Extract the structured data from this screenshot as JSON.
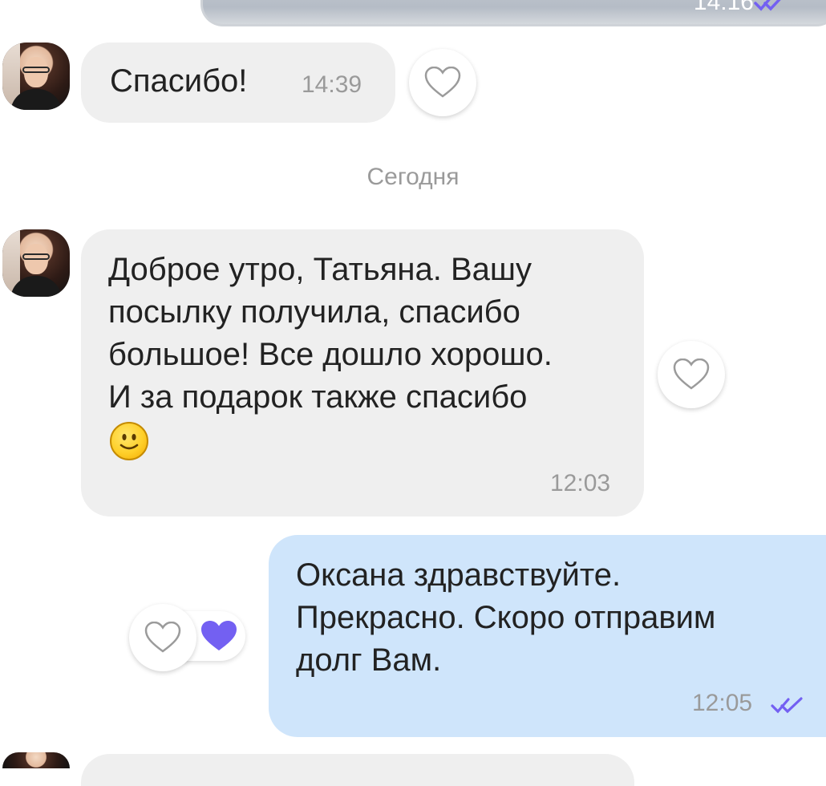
{
  "colors": {
    "incoming_bubble": "#efefef",
    "outgoing_bubble": "#cfe5fb",
    "accent_purple": "#7360f2",
    "timestamp": "#9a9a9a",
    "text": "#222222"
  },
  "previous_message": {
    "time": "14:16",
    "status_icon": "double-check-icon"
  },
  "messages": [
    {
      "direction": "incoming",
      "text": "Спасибо!",
      "time": "14:39",
      "liked": false
    },
    {
      "direction": "incoming",
      "text": "Доброе утро, Татьяна. Вашу\nпосылку получила, спасибо\nбольшое! Все дошло хорошо.\nИ за подарок также спасибо",
      "emoji": "slightly-smiling-face-emoji",
      "time": "12:03",
      "liked": false
    },
    {
      "direction": "outgoing",
      "text": "Оксана здравствуйте.\nПрекрасно. Скоро отправим\nдолг Вам.",
      "time": "12:05",
      "status_icon": "double-check-icon",
      "reaction": "purple-heart-icon"
    }
  ],
  "date_separator": "Сегодня"
}
